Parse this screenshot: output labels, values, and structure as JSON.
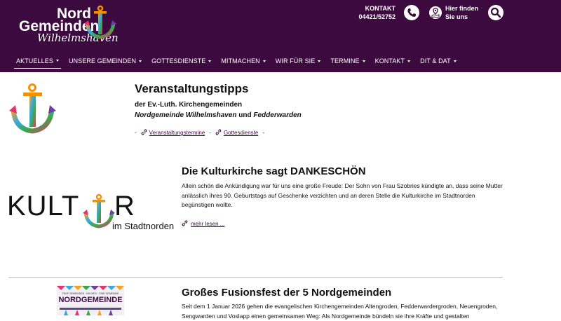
{
  "header": {
    "logo": {
      "line1": "Nord",
      "line2": "Gemeinden",
      "line3": "Wilhelmshaven"
    },
    "contact": {
      "label": "KONTAKT",
      "phone": "04421/52752"
    },
    "find": {
      "line1": "Hier finden",
      "line2": "Sie uns"
    }
  },
  "nav": {
    "items": [
      {
        "label": "AKTUELLES",
        "has_dropdown": true,
        "active": true
      },
      {
        "label": "UNSERE GEMEINDEN",
        "has_dropdown": true
      },
      {
        "label": "GOTTESDIENSTE",
        "has_dropdown": true
      },
      {
        "label": "MITMACHEN",
        "has_dropdown": true
      },
      {
        "label": "WIR FÜR SIE",
        "has_dropdown": true
      },
      {
        "label": "TERMINE",
        "has_dropdown": true
      },
      {
        "label": "KONTAKT",
        "has_dropdown": true
      },
      {
        "label": "DIT & DAT",
        "has_dropdown": true
      }
    ]
  },
  "intro": {
    "title": "Veranstaltungstipps",
    "subtitle": "der Ev.-Luth. Kirchengemeinden",
    "line_italic1": "Nordgemeinde Wilhelmshaven",
    "line_and": "und",
    "line_italic2": "Fedderwarden",
    "link1": "Veranstaltungstermine",
    "link2": "Gottesdienste",
    "dash": "-"
  },
  "article1": {
    "logo_text1": "KULT",
    "logo_text2": "R",
    "logo_sub": "im Stadtnorden",
    "title": "Die Kulturkirche sagt DANKESCHÖN",
    "text": "Allein schön die Ankündigung war für uns eine große Freude: Der Sohn von Frau Szobries kündigte an, dass seine Mutter anlässlich ihres 90. Geburtstags auf Geschenke verzichten und an deren Stelle die Kulturkirche im Stadtnorden begünstigen wollte.",
    "read_more": "mehr lesen ..."
  },
  "article2": {
    "poster_small": "FÜNF GEMEINDEN · EIN WEG · EINE GEMEINDE",
    "poster_title": "NORDGEMEINDE",
    "title": "Großes Fusionsfest der 5 Nordgemeinden",
    "text": "Seit dem 1 Januar 2026 gehen die evangelischen Kirchengemeinden Altengroden, Fedderwardergroden, Neuengroden, Sengwarden und Voslapp einen gemeinsamen Weg: Als Nordgemeinde bündeln sie ihre Kräfte und gestalten"
  },
  "colors": {
    "brand": "#3d0a3f",
    "white": "#ffffff"
  }
}
